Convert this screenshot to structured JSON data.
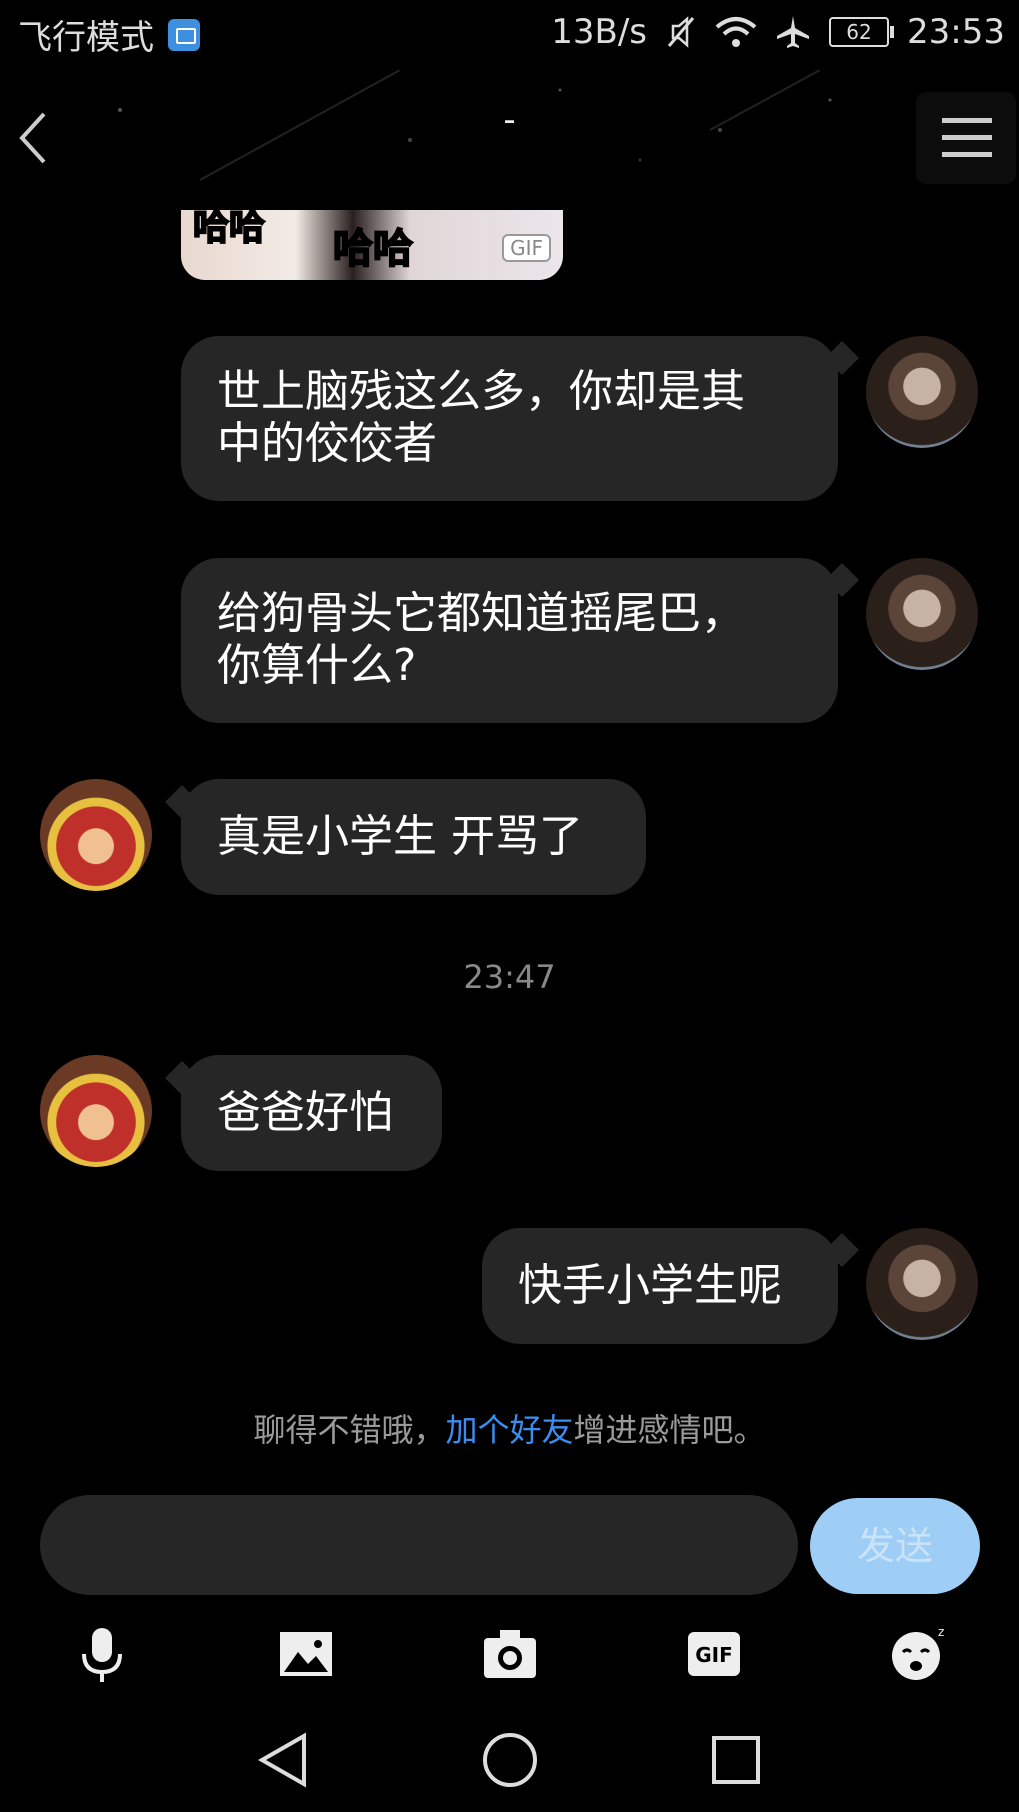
{
  "status_bar": {
    "left_text": "飞行模式",
    "net_speed": "13B/s",
    "battery": "62",
    "time": "23:53",
    "icons": [
      "image-notification-icon",
      "mute-icon",
      "wifi-icon",
      "airplane-icon",
      "battery-icon"
    ]
  },
  "header": {
    "title": "-",
    "back_icon": "chevron-left-icon",
    "menu_icon": "hamburger-menu-icon"
  },
  "gif_sticker": {
    "text_left": "哈哈",
    "text_right": "哈哈",
    "badge": "GIF"
  },
  "messages": [
    {
      "side": "right",
      "text_line1": "世上脑残这么多，你却是其",
      "text_line2": "中的佼佼者"
    },
    {
      "side": "right",
      "text_line1": "给狗骨头它都知道摇尾巴，",
      "text_line2": "你算什么?"
    },
    {
      "side": "left",
      "text": "真是小学生 开骂了"
    },
    {
      "side": "left",
      "text": "爸爸好怕"
    },
    {
      "side": "right",
      "text": "快手小学生呢"
    }
  ],
  "timestamp": "23:47",
  "tip": {
    "prefix": "聊得不错哦，",
    "link": "加个好友",
    "suffix": "增进感情吧。"
  },
  "composer": {
    "input_value": "",
    "send_label": "发送"
  },
  "toolbar": [
    "microphone-icon",
    "image-icon",
    "camera-icon",
    "gif-icon",
    "sleepy-emoji-icon"
  ],
  "toolbar_gif_label": "GIF",
  "navbar": [
    "back-triangle-icon",
    "home-circle-icon",
    "recents-square-icon"
  ],
  "colors": {
    "background": "#000000",
    "bubble": "#262626",
    "link": "#3b8df0",
    "send_button": "#9ecdf5"
  }
}
